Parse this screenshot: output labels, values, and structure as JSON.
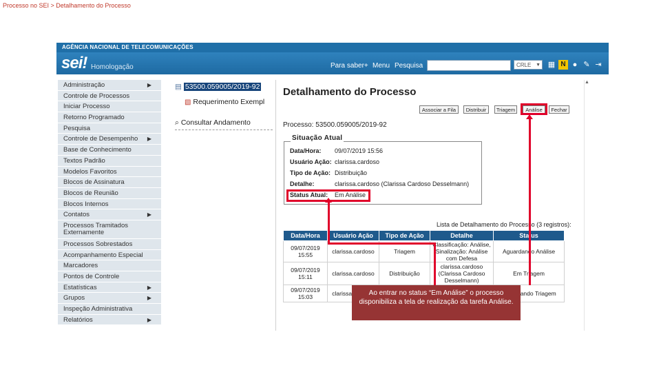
{
  "slide": {
    "title": "Processo no SEI > Detalhamento do Processo"
  },
  "app": {
    "agency": "AGÊNCIA NACIONAL DE TELECOMUNICAÇÕES",
    "logo": "sei!",
    "environment": "Homologação",
    "top_links": [
      "Para saber+",
      "Menu",
      "Pesquisa"
    ],
    "search_placeholder": "",
    "org_select": "CRLE"
  },
  "sidebar": {
    "items": [
      {
        "label": "Administração",
        "submenu": true
      },
      {
        "label": "Controle de Processos",
        "submenu": false
      },
      {
        "label": "Iniciar Processo",
        "submenu": false
      },
      {
        "label": "Retorno Programado",
        "submenu": false
      },
      {
        "label": "Pesquisa",
        "submenu": false
      },
      {
        "label": "Controle de Desempenho",
        "submenu": true
      },
      {
        "label": "Base de Conhecimento",
        "submenu": false
      },
      {
        "label": "Textos Padrão",
        "submenu": false
      },
      {
        "label": "Modelos Favoritos",
        "submenu": false
      },
      {
        "label": "Blocos de Assinatura",
        "submenu": false
      },
      {
        "label": "Blocos de Reunião",
        "submenu": false
      },
      {
        "label": "Blocos Internos",
        "submenu": false
      },
      {
        "label": "Contatos",
        "submenu": true
      },
      {
        "label": "Processos Tramitados Externamente",
        "submenu": false
      },
      {
        "label": "Processos Sobrestados",
        "submenu": false
      },
      {
        "label": "Acompanhamento Especial",
        "submenu": false
      },
      {
        "label": "Marcadores",
        "submenu": false
      },
      {
        "label": "Pontos de Controle",
        "submenu": false
      },
      {
        "label": "Estatísticas",
        "submenu": true
      },
      {
        "label": "Grupos",
        "submenu": true
      },
      {
        "label": "Inspeção Administrativa",
        "submenu": false
      },
      {
        "label": "Relatórios",
        "submenu": true
      }
    ]
  },
  "tree": {
    "process_number": "53500.059005/2019-92",
    "document": "Requerimento Exempl",
    "consult": "Consultar Andamento"
  },
  "detail": {
    "title": "Detalhamento do Processo",
    "buttons": [
      "Associar a Fila",
      "Distribuir",
      "Triagem",
      "Análise",
      "Fechar"
    ],
    "process_label": "Processo:",
    "process_value": "53500.059005/2019-92",
    "situation": {
      "legend": "Situação Atual",
      "rows": [
        {
          "key": "Data/Hora:",
          "value": "09/07/2019 15:56"
        },
        {
          "key": "Usuário Ação:",
          "value": "clarissa.cardoso"
        },
        {
          "key": "Tipo de Ação:",
          "value": "Distribuição"
        },
        {
          "key": "Detalhe:",
          "value": "clarissa.cardoso (Clarissa Cardoso Desselmann)"
        },
        {
          "key": "Status Atual:",
          "value": "Em Análise"
        }
      ]
    },
    "list_caption": "Lista de Detalhamento do Processo (3 registros):",
    "table": {
      "headers": [
        "Data/Hora",
        "Usuário Ação",
        "Tipo de Ação",
        "Detalhe",
        "Status"
      ],
      "rows": [
        [
          "09/07/2019 15:55",
          "clarissa.cardoso",
          "Triagem",
          "Classificação: Análise, Sinalização: Análise com Defesa",
          "Aguardando Análise"
        ],
        [
          "09/07/2019 15:11",
          "clarissa.cardoso",
          "Distribuição",
          "clarissa.cardoso (Clarissa Cardoso Desselmann)",
          "Em Triagem"
        ],
        [
          "09/07/2019 15:03",
          "clarissa.cardoso",
          "",
          "",
          "Aguardando Triagem"
        ]
      ]
    }
  },
  "callout": {
    "text": "Ao entrar no status “Em Análise” o processo disponibiliza a tela de realização da tarefa Análise."
  },
  "colors": {
    "header": "#2f82bd",
    "highlight": "#e0002a",
    "callout": "#963434",
    "table_header": "#1f5a8c"
  }
}
